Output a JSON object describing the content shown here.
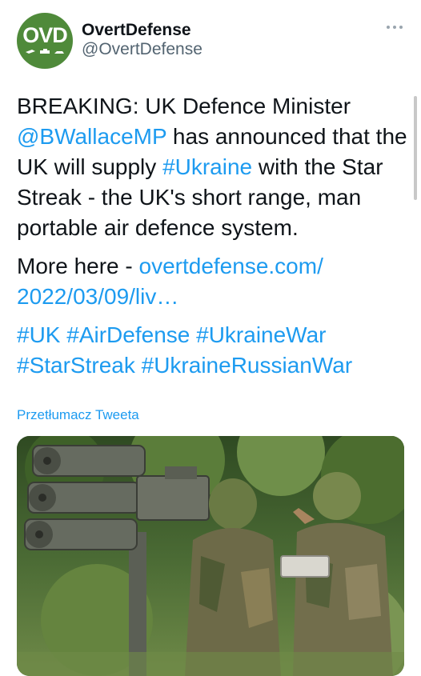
{
  "author": {
    "display_name": "OvertDefense",
    "handle": "@OvertDefense",
    "avatar_text": "OVD"
  },
  "tweet": {
    "line1_text": "BREAKING: UK Defence Minister",
    "mention": "@BWallaceMP",
    "line2_text": " has announced that the UK will supply ",
    "hashtag_ukraine": "#Ukraine",
    "line3_text": " with the Star Streak - the UK's short range, man portable air defence system.",
    "more_label": "More here - ",
    "link_text": "overtdefense.com/ 2022/03/09/liv…",
    "hashtags": [
      "#UK",
      "#AirDefense",
      "#UkraineWar",
      "#StarStreak",
      "#UkraineRussianWar"
    ]
  },
  "translate_label": "Przetłumacz Tweeta",
  "colors": {
    "link": "#1d9bf0",
    "text": "#0f1419",
    "secondary": "#536471",
    "avatar": "#4f8a3a"
  },
  "icons": {
    "more": "more-options-icon"
  }
}
